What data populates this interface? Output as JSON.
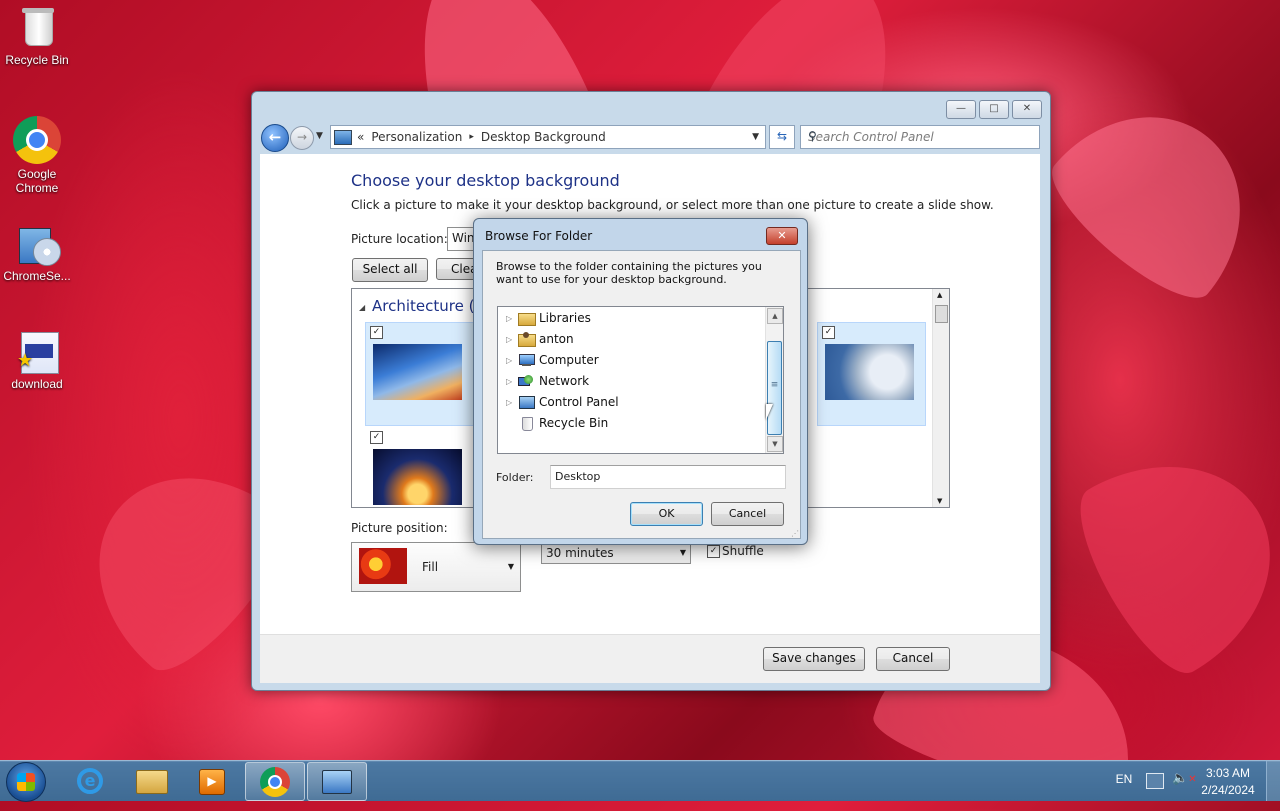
{
  "desktop": {
    "icons": [
      {
        "label": "Recycle Bin",
        "icon": "recycle-bin-icon"
      },
      {
        "label": "Google Chrome",
        "icon": "chrome-icon"
      },
      {
        "label": "ChromeSe...",
        "icon": "installer-icon"
      },
      {
        "label": "download",
        "icon": "image-file-icon"
      }
    ]
  },
  "window": {
    "controls": {
      "minimize": "—",
      "maximize": "□",
      "close": "✕"
    },
    "address": {
      "chevrons": "«",
      "crumbs": [
        "Personalization",
        "Desktop Background"
      ],
      "separator": "▸"
    },
    "search": {
      "placeholder": "Search Control Panel"
    },
    "heading": "Choose your desktop background",
    "description": "Click a picture to make it your desktop background, or select more than one picture to create a slide show.",
    "picture_location_label": "Picture location:",
    "picture_location_value": "Wind",
    "select_all": "Select all",
    "clear_all": "Clea",
    "group": {
      "title": "Architecture (6)"
    },
    "picture_position_label": "Picture position:",
    "picture_position_value": "Fill",
    "interval_value": "30 minutes",
    "shuffle_label": "Shuffle",
    "shuffle_checked": true,
    "save_changes": "Save changes",
    "cancel": "Cancel"
  },
  "dialog": {
    "title": "Browse For Folder",
    "instructions": "Browse to the folder containing the pictures you want to use for your desktop background.",
    "tree": [
      {
        "label": "Libraries",
        "icon": "library-folder-icon",
        "expandable": true
      },
      {
        "label": "anton",
        "icon": "user-folder-icon",
        "expandable": true
      },
      {
        "label": "Computer",
        "icon": "computer-icon",
        "expandable": true
      },
      {
        "label": "Network",
        "icon": "network-icon",
        "expandable": true
      },
      {
        "label": "Control Panel",
        "icon": "control-panel-icon",
        "expandable": true
      },
      {
        "label": "Recycle Bin",
        "icon": "recycle-bin-icon",
        "expandable": false
      }
    ],
    "folder_label": "Folder:",
    "folder_value": "Desktop",
    "ok": "OK",
    "cancel": "Cancel"
  },
  "taskbar": {
    "items": [
      "start-button",
      "internet-explorer-icon",
      "file-explorer-icon",
      "media-player-icon",
      "chrome-icon",
      "control-panel-icon"
    ],
    "language": "EN",
    "time": "3:03 AM",
    "date": "2/24/2024"
  }
}
